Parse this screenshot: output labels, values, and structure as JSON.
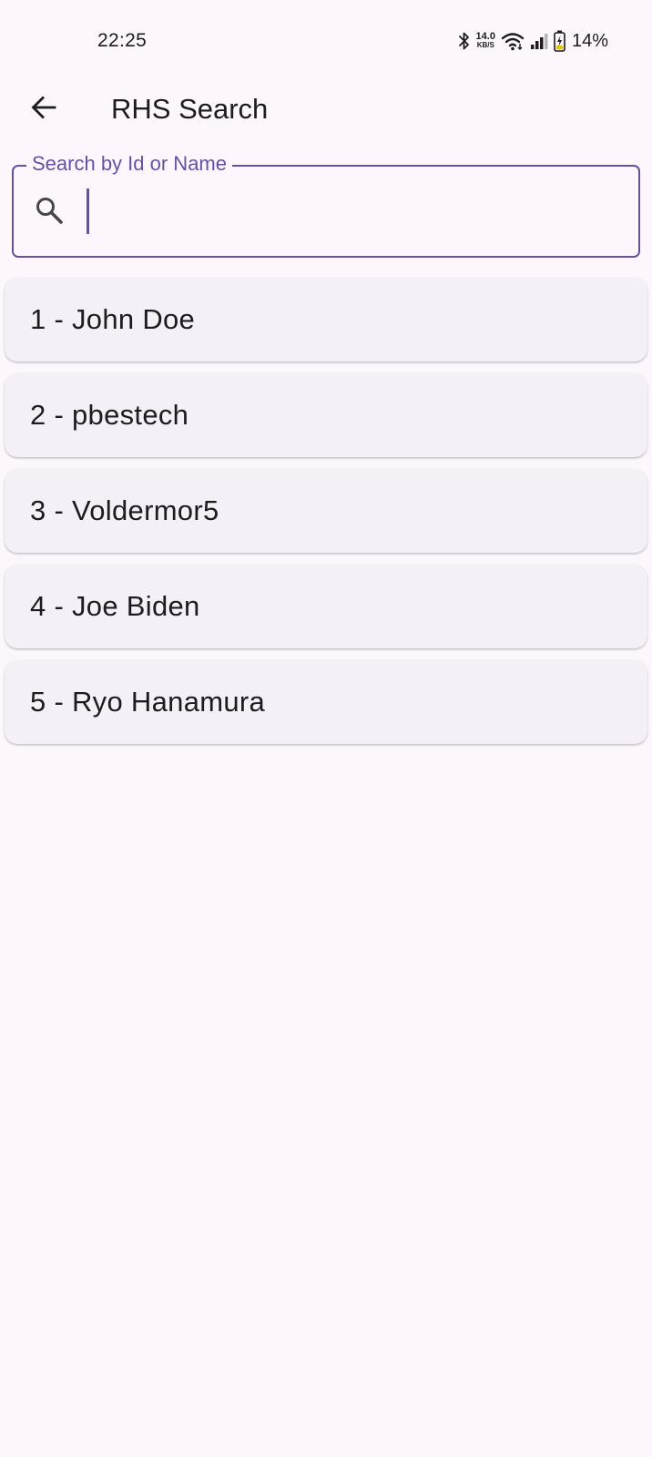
{
  "status_bar": {
    "time": "22:25",
    "net_speed_value": "14.0",
    "net_speed_unit": "KB/S",
    "battery_percent": "14%",
    "icons": [
      "bluetooth-icon",
      "wifi-icon",
      "signal-icon",
      "battery-charging-icon"
    ]
  },
  "app_bar": {
    "title": "RHS Search",
    "back_icon": "arrow-left-icon"
  },
  "search": {
    "label": "Search by Id or Name",
    "value": "",
    "icon": "search-icon"
  },
  "results": [
    {
      "label": "1 - John Doe"
    },
    {
      "label": "2 - pbestech"
    },
    {
      "label": "3 - Voldermor5"
    },
    {
      "label": "4 - Joe Biden"
    },
    {
      "label": "5 - Ryo Hanamura"
    }
  ],
  "colors": {
    "background": "#fdf7fd",
    "primary": "#6750a4",
    "card": "#f5f0f7",
    "text": "#1d1b20"
  }
}
